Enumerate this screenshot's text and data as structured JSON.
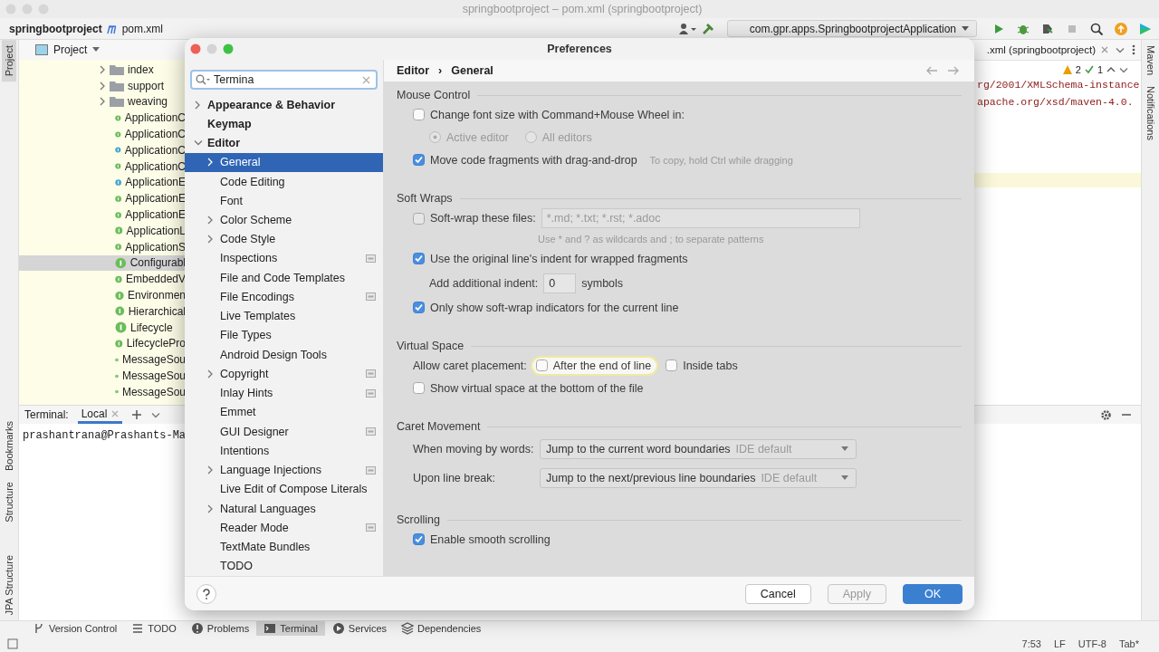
{
  "ide": {
    "title": "springbootproject – pom.xml (springbootproject)",
    "breadcrumb": [
      "springbootproject",
      "pom.xml"
    ],
    "run_config": "com.gpr.apps.SpringbootprojectApplication",
    "left_strip": [
      {
        "label": "Project",
        "selected": true
      },
      {
        "label": "Bookmarks",
        "selected": false
      },
      {
        "label": "Structure",
        "selected": false
      },
      {
        "label": "JPA Structure",
        "selected": false
      }
    ],
    "right_strip": [
      "Maven",
      "Notifications"
    ],
    "project": {
      "title": "Project",
      "items": [
        {
          "label": "index",
          "kind": "folder",
          "selected": false
        },
        {
          "label": "support",
          "kind": "folder",
          "selected": false
        },
        {
          "label": "weaving",
          "kind": "folder",
          "selected": false
        },
        {
          "label": "ApplicationC",
          "kind": "interface",
          "selected": false
        },
        {
          "label": "ApplicationC",
          "kind": "interface",
          "selected": false
        },
        {
          "label": "ApplicationC",
          "kind": "class",
          "selected": false
        },
        {
          "label": "ApplicationC",
          "kind": "interface",
          "selected": false
        },
        {
          "label": "ApplicationE",
          "kind": "class",
          "selected": false
        },
        {
          "label": "ApplicationE",
          "kind": "interface",
          "selected": false
        },
        {
          "label": "ApplicationE",
          "kind": "interface",
          "selected": false
        },
        {
          "label": "ApplicationL",
          "kind": "interface",
          "selected": false
        },
        {
          "label": "ApplicationS",
          "kind": "interface",
          "selected": false
        },
        {
          "label": "Configurabl",
          "kind": "interface",
          "selected": true
        },
        {
          "label": "EmbeddedV",
          "kind": "interface",
          "selected": false
        },
        {
          "label": "Environmen",
          "kind": "interface",
          "selected": false
        },
        {
          "label": "Hierarchical",
          "kind": "interface",
          "selected": false
        },
        {
          "label": "Lifecycle",
          "kind": "interface",
          "selected": false
        },
        {
          "label": "LifecyclePro",
          "kind": "interface",
          "selected": false
        },
        {
          "label": "MessageSou",
          "kind": "interface",
          "selected": false
        },
        {
          "label": "MessageSou",
          "kind": "interface",
          "selected": false
        },
        {
          "label": "MessageSou",
          "kind": "interface",
          "selected": false
        }
      ]
    },
    "editor": {
      "tab": ".xml (springbootproject)",
      "warnings": "2",
      "passed": "1",
      "lines": [
        "rg/2001/XMLSchema-instance",
        "apache.org/xsd/maven-4.0."
      ]
    },
    "terminal": {
      "title": "Terminal:",
      "tabs": [
        {
          "label": "Local",
          "selected": true
        }
      ],
      "text": "prashantrana@Prashants-Ma"
    },
    "tool_tabs": [
      {
        "label": "Version Control",
        "kind": "branch",
        "selected": false
      },
      {
        "label": "TODO",
        "kind": "list",
        "selected": false
      },
      {
        "label": "Problems",
        "kind": "problems",
        "selected": false
      },
      {
        "label": "Terminal",
        "kind": "terminal",
        "selected": true
      },
      {
        "label": "Services",
        "kind": "services",
        "selected": false
      },
      {
        "label": "Dependencies",
        "kind": "stack",
        "selected": false
      }
    ],
    "status": [
      "7:53",
      "LF",
      "UTF-8",
      "Tab*"
    ]
  },
  "dialog": {
    "title": "Preferences",
    "search": {
      "value": "Termina"
    },
    "tree": [
      {
        "label": "Appearance & Behavior",
        "kind": "group",
        "expanded": false,
        "selected": false,
        "badge": false
      },
      {
        "label": "Keymap",
        "kind": "page",
        "selected": false,
        "badge": false
      },
      {
        "label": "Editor",
        "kind": "group",
        "expanded": true,
        "selected": false,
        "badge": false,
        "children": [
          {
            "label": "General",
            "kind": "group",
            "expanded": false,
            "selected": true,
            "badge": false
          },
          {
            "label": "Code Editing",
            "kind": "page",
            "selected": false,
            "badge": false
          },
          {
            "label": "Font",
            "kind": "page",
            "selected": false,
            "badge": false
          },
          {
            "label": "Color Scheme",
            "kind": "group",
            "expanded": false,
            "selected": false,
            "badge": false
          },
          {
            "label": "Code Style",
            "kind": "group",
            "expanded": false,
            "selected": false,
            "badge": false
          },
          {
            "label": "Inspections",
            "kind": "page",
            "selected": false,
            "badge": true
          },
          {
            "label": "File and Code Templates",
            "kind": "page",
            "selected": false,
            "badge": false
          },
          {
            "label": "File Encodings",
            "kind": "page",
            "selected": false,
            "badge": true
          },
          {
            "label": "Live Templates",
            "kind": "page",
            "selected": false,
            "badge": false
          },
          {
            "label": "File Types",
            "kind": "page",
            "selected": false,
            "badge": false
          },
          {
            "label": "Android Design Tools",
            "kind": "page",
            "selected": false,
            "badge": false
          },
          {
            "label": "Copyright",
            "kind": "group",
            "expanded": false,
            "selected": false,
            "badge": true
          },
          {
            "label": "Inlay Hints",
            "kind": "page",
            "selected": false,
            "badge": true
          },
          {
            "label": "Emmet",
            "kind": "page",
            "selected": false,
            "badge": false
          },
          {
            "label": "GUI Designer",
            "kind": "page",
            "selected": false,
            "badge": true
          },
          {
            "label": "Intentions",
            "kind": "page",
            "selected": false,
            "badge": false
          },
          {
            "label": "Language Injections",
            "kind": "group",
            "expanded": false,
            "selected": false,
            "badge": true
          },
          {
            "label": "Live Edit of Compose Literals",
            "kind": "page",
            "selected": false,
            "badge": false
          },
          {
            "label": "Natural Languages",
            "kind": "group",
            "expanded": false,
            "selected": false,
            "badge": false
          },
          {
            "label": "Reader Mode",
            "kind": "page",
            "selected": false,
            "badge": true
          },
          {
            "label": "TextMate Bundles",
            "kind": "page",
            "selected": false,
            "badge": false
          },
          {
            "label": "TODO",
            "kind": "page",
            "selected": false,
            "badge": false
          }
        ]
      }
    ],
    "breadcrumb": [
      "Editor",
      "›",
      "General"
    ],
    "sections": [
      {
        "title": "Mouse Control",
        "rows": [
          {
            "kind": "checkbox",
            "label": "Change font size with Command+Mouse Wheel in:",
            "checked": false
          },
          {
            "kind": "radio_group",
            "disabled": true,
            "options": [
              {
                "label": "Active editor",
                "selected": true
              },
              {
                "label": "All editors",
                "selected": false
              }
            ]
          },
          {
            "kind": "checkbox",
            "label": "Move code fragments with drag-and-drop",
            "checked": true,
            "hint": "To copy, hold Ctrl while dragging"
          }
        ]
      },
      {
        "title": "Soft Wraps",
        "rows": [
          {
            "kind": "checkbox_field",
            "label": "Soft-wrap these files:",
            "checked": false,
            "value": "*.md; *.txt; *.rst; *.adoc",
            "disabled": true
          },
          {
            "kind": "note",
            "text": "Use * and ? as wildcards and ; to separate patterns"
          },
          {
            "kind": "checkbox",
            "label": "Use the original line's indent for wrapped fragments",
            "checked": true
          },
          {
            "kind": "number",
            "label": "Add additional indent:",
            "value": "0",
            "suffix": "symbols"
          },
          {
            "kind": "checkbox",
            "label": "Only show soft-wrap indicators for the current line",
            "checked": true
          }
        ]
      },
      {
        "title": "Virtual Space",
        "rows": [
          {
            "kind": "checkbox_group",
            "label": "Allow caret placement:",
            "options": [
              {
                "label": "After the end of line",
                "checked": false,
                "focused": true
              },
              {
                "label": "Inside tabs",
                "checked": false,
                "focused": false
              }
            ]
          },
          {
            "kind": "checkbox",
            "label": "Show virtual space at the bottom of the file",
            "checked": false
          }
        ]
      },
      {
        "title": "Caret Movement",
        "rows": [
          {
            "kind": "dropdown",
            "label": "When moving by words:",
            "value": "Jump to the current word boundaries",
            "note": "IDE default"
          },
          {
            "kind": "dropdown",
            "label": "Upon line break:",
            "value": "Jump to the next/previous line boundaries",
            "note": "IDE default"
          }
        ]
      },
      {
        "title": "Scrolling",
        "rows": [
          {
            "kind": "checkbox",
            "label": "Enable smooth scrolling",
            "checked": true
          }
        ]
      }
    ],
    "buttons": [
      {
        "label": "Cancel",
        "kind": "secondary",
        "disabled": false
      },
      {
        "label": "Apply",
        "kind": "secondary",
        "disabled": true
      },
      {
        "label": "OK",
        "kind": "primary",
        "disabled": false
      }
    ]
  }
}
